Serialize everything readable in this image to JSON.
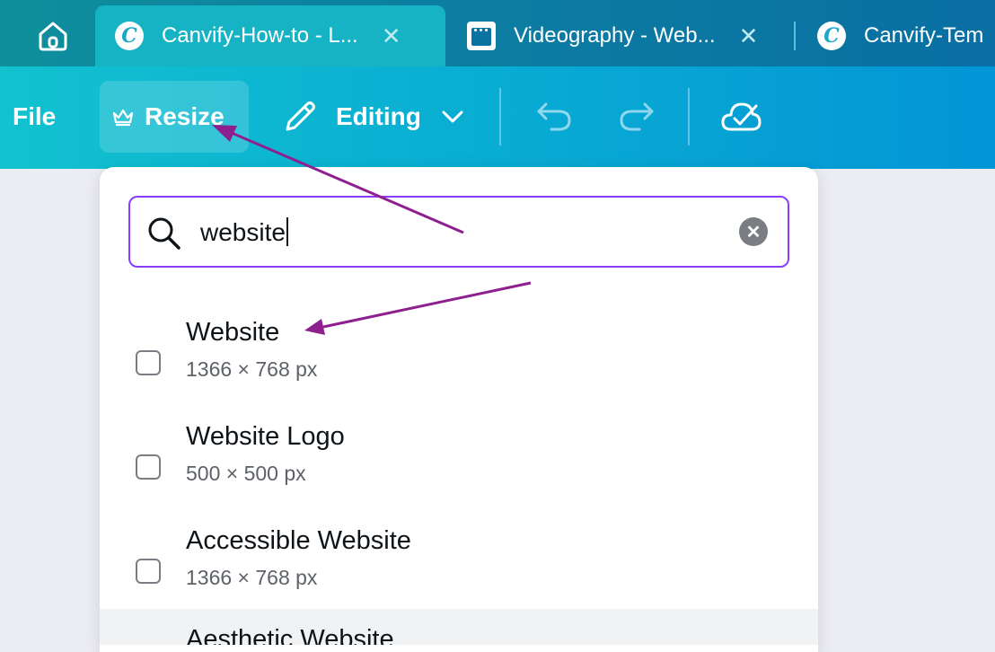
{
  "tabs": [
    {
      "title": "Canvify-How-to - L...",
      "close": "✕",
      "icon": "canvify-logo-icon",
      "logo_letter": "C"
    },
    {
      "title": "Videography - Web...",
      "close": "✕",
      "icon": "browser-window-icon"
    },
    {
      "title": "Canvify-Tem",
      "icon": "canvify-logo-icon",
      "logo_letter": "C"
    }
  ],
  "toolbar": {
    "file_label": "File",
    "resize_label": "Resize",
    "editing_label": "Editing",
    "icons": [
      "crown-icon",
      "pencil-icon",
      "chevron-down-icon",
      "undo-icon",
      "redo-icon",
      "cloud-check-icon"
    ]
  },
  "search": {
    "value": "website",
    "clear_symbol": "✕",
    "icon": "search-icon"
  },
  "results": [
    {
      "name": "Website",
      "size": "1366 × 768 px"
    },
    {
      "name": "Website Logo",
      "size": "500 × 500 px"
    },
    {
      "name": "Accessible Website",
      "size": "1366 × 768 px"
    },
    {
      "name": "Aesthetic Website",
      "size": ""
    }
  ],
  "colors": {
    "accent": "#8b3dff",
    "annotation_arrow": "#8e1f8f",
    "toolbar_start": "#12c2cf",
    "toolbar_end": "#0395d6"
  }
}
